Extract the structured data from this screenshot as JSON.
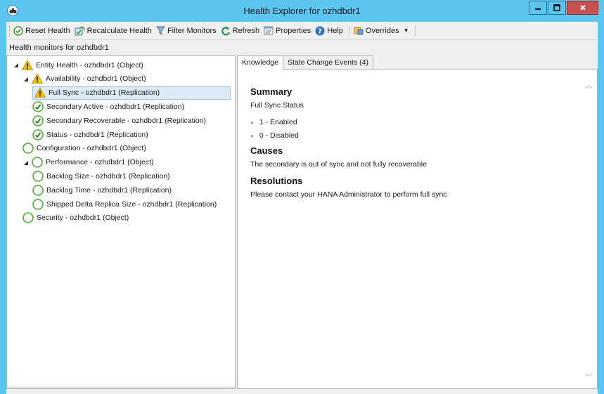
{
  "window": {
    "title": "Health Explorer for ozhdbdr1",
    "controls": [
      "minimize",
      "maximize",
      "close"
    ]
  },
  "toolbar": {
    "reset_health": "Reset Health",
    "recalculate_health": "Recalculate Health",
    "filter_monitors": "Filter Monitors",
    "refresh": "Refresh",
    "properties": "Properties",
    "help": "Help",
    "overrides": "Overrides"
  },
  "header": {
    "label": "Health monitors for ozhdbdr1"
  },
  "tree": [
    {
      "label": "Entity Health - ozhdbdr1 (Object)",
      "state": "warning",
      "expanded": true
    },
    {
      "label": "Availability - ozhdbdr1 (Object)",
      "state": "warning",
      "expanded": true
    },
    {
      "label": "Full Sync - ozhdbdr1 (Replication)",
      "state": "warning",
      "selected": true
    },
    {
      "label": "Secondary Active - ozhdbdr1 (Replication)",
      "state": "healthy"
    },
    {
      "label": "Secondary Recoverable - ozhdbdr1 (Replication)",
      "state": "healthy"
    },
    {
      "label": "Status - ozhdbdr1 (Replication)",
      "state": "healthy"
    },
    {
      "label": "Configuration - ozhdbdr1 (Object)",
      "state": "unmonitored"
    },
    {
      "label": "Performance - ozhdbdr1 (Object)",
      "state": "unmonitored",
      "expanded": true
    },
    {
      "label": "Backlog Size - ozhdbdr1 (Replication)",
      "state": "unmonitored"
    },
    {
      "label": "Backlog Time - ozhdbdr1 (Replication)",
      "state": "unmonitored"
    },
    {
      "label": "Shipped Delta Replica Size - ozhdbdr1 (Replication)",
      "state": "unmonitored"
    },
    {
      "label": "Security - ozhdbdr1 (Object)",
      "state": "unmonitored"
    }
  ],
  "tabs": [
    {
      "label": "Knowledge",
      "active": true
    },
    {
      "label": "State Change Events (4)",
      "active": false
    }
  ],
  "knowledge": {
    "summary_heading": "Summary",
    "summary_text": "Full Sync Status",
    "summary_items": [
      "1 - Enabled",
      "0 - Disabled"
    ],
    "causes_heading": "Causes",
    "causes_text": "The secondary is out of sync and not fully recoverable",
    "resolutions_heading": "Resolutions",
    "resolutions_text": "Please contact your HANA Administrator to perform full sync"
  },
  "colors": {
    "titlebar": "#5cc5f0",
    "healthy": "#4caf2e",
    "warning": "#f2c200",
    "unmonitored": "#4caf2e",
    "selection": "#dbe9f8"
  }
}
